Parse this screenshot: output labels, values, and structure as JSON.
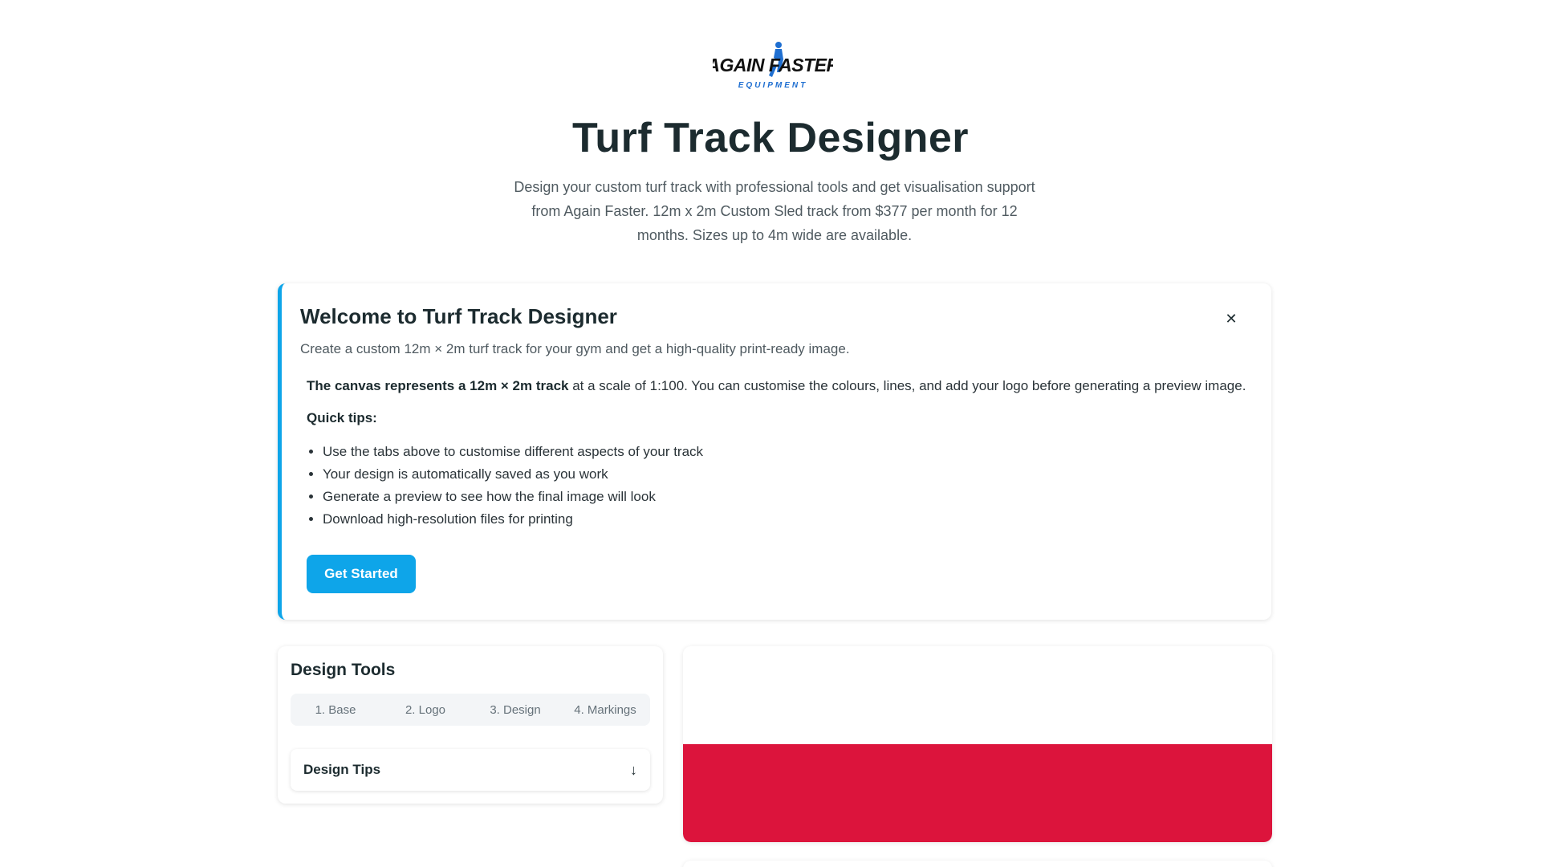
{
  "brand": {
    "logo_top": "AGAIN FASTER",
    "logo_bottom": "EQUIPMENT",
    "accent_color": "#0ea5e9"
  },
  "header": {
    "title": "Turf Track Designer",
    "subtitle": "Design your custom turf track with professional tools and get visualisation support from Again Faster. 12m x 2m Custom Sled track from $377 per month for 12 months. Sizes up to 4m wide are available."
  },
  "welcome": {
    "title": "Welcome to Turf Track Designer",
    "description": "Create a custom 12m × 2m turf track for your gym and get a high-quality print-ready image.",
    "scale_bold": "The canvas represents a 12m × 2m track",
    "scale_rest": " at a scale of 1:100. You can customise the colours, lines, and add your logo before generating a preview image.",
    "tips_heading": "Quick tips:",
    "tips": [
      "Use the tabs above to customise different aspects of your track",
      "Your design is automatically saved as you work",
      "Generate a preview to see how the final image will look",
      "Download high-resolution files for printing"
    ],
    "button_label": "Get Started",
    "close_icon": "close-icon"
  },
  "tools": {
    "title": "Design Tools",
    "tabs": [
      "1. Base",
      "2. Logo",
      "3. Design",
      "4. Markings"
    ],
    "accordion_label": "Design Tips",
    "accordion_icon": "arrow-down-icon"
  },
  "preview": {
    "track_color": "#dc143c"
  }
}
